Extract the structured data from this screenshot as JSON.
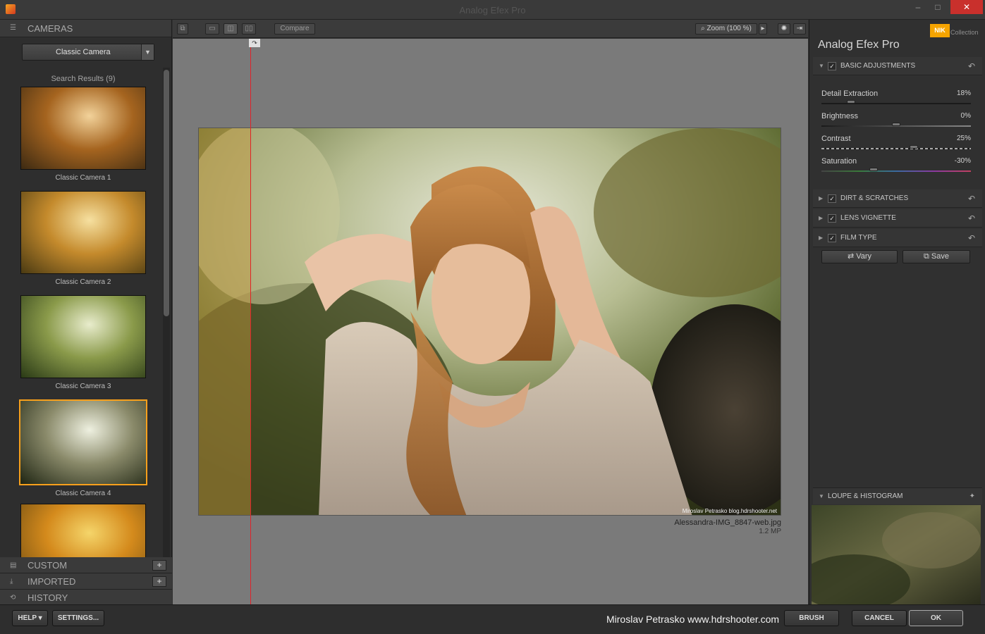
{
  "window": {
    "title": "Analog Efex Pro",
    "minimize": "–",
    "restore": "□",
    "close": "✕"
  },
  "left_panel": {
    "cameras_header": "CAMERAS",
    "camera_dropdown": "Classic Camera",
    "search_results": "Search Results (9)",
    "presets": [
      {
        "label": "Classic Camera 1",
        "selected": false
      },
      {
        "label": "Classic Camera 2",
        "selected": false
      },
      {
        "label": "Classic Camera 3",
        "selected": false
      },
      {
        "label": "Classic Camera 4",
        "selected": true
      },
      {
        "label": "",
        "selected": false
      }
    ],
    "sections": [
      {
        "label": "CUSTOM",
        "has_add": true,
        "icon": "folder-icon"
      },
      {
        "label": "IMPORTED",
        "has_add": true,
        "icon": "import-icon"
      },
      {
        "label": "HISTORY",
        "has_add": false,
        "icon": "history-icon"
      }
    ],
    "add_symbol": "+"
  },
  "toolbar": {
    "compare_label": "Compare",
    "zoom_label": "Zoom (100 %)",
    "zoom_arrow": "▸"
  },
  "canvas": {
    "split_handle": "↷",
    "filename": "Alessandra-IMG_8847-web.jpg",
    "filesize": "1.2 MP",
    "watermark": "Miroslav Petrasko blog.hdrshooter.net"
  },
  "right_panel": {
    "brand_badge": "NIK",
    "brand_collection": "Collection",
    "title": "Analog Efex Pro",
    "groups": {
      "basic": {
        "label": "BASIC ADJUSTMENTS",
        "expanded": true,
        "checked": true
      },
      "dirt": {
        "label": "DIRT & SCRATCHES",
        "expanded": false,
        "checked": true
      },
      "vignette": {
        "label": "LENS VIGNETTE",
        "expanded": false,
        "checked": true
      },
      "film": {
        "label": "FILM TYPE",
        "expanded": false,
        "checked": true
      }
    },
    "check_mark": "✓",
    "expand_open": "▼",
    "expand_closed": "▶",
    "reset_symbol": "↶",
    "sliders": [
      {
        "name": "Detail Extraction",
        "value": "18%",
        "level": 0.2
      },
      {
        "name": "Brightness",
        "value": "0%",
        "level": 0.5
      },
      {
        "name": "Contrast",
        "value": "25%",
        "level": 0.62
      },
      {
        "name": "Saturation",
        "value": "-30%",
        "level": 0.35
      }
    ],
    "vary_label": "Vary",
    "save_label": "Save",
    "loupe_label": "LOUPE & HISTOGRAM",
    "pin_symbol": "✦"
  },
  "bottom_bar": {
    "help_label": "HELP ▾",
    "settings_label": "SETTINGS...",
    "credit": "Miroslav Petrasko www.hdrshooter.com",
    "brush_label": "BRUSH",
    "cancel_label": "CANCEL",
    "ok_label": "OK"
  },
  "colors": {
    "accent": "#f7a01c",
    "split_line": "#e0232a",
    "canvas_bg": "#7a7a7a"
  }
}
